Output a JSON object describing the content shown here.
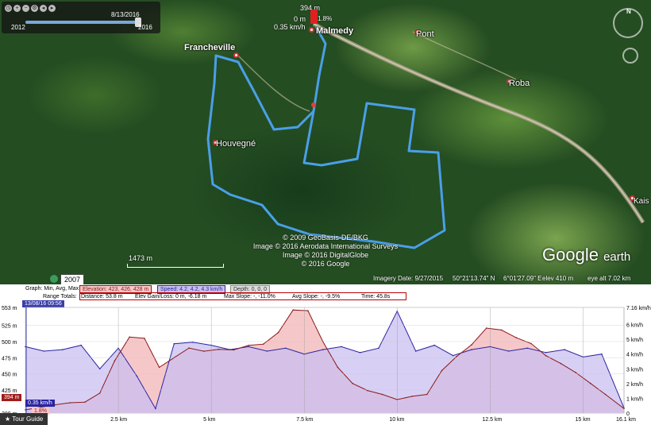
{
  "map": {
    "places": [
      {
        "name": "Francheville"
      },
      {
        "name": "Malmedy"
      },
      {
        "name": "Pont"
      },
      {
        "name": "Roba"
      },
      {
        "name": "Houvegné"
      },
      {
        "name": "Kais"
      }
    ],
    "copyright_lines": [
      "© 2009 GeoBasis-DE/BKG",
      "Image © 2016 Aerodata International Surveys",
      "Image © 2016 DigitalGlobe",
      "© 2016 Google"
    ],
    "logo_text": "Google",
    "logo_suffix": "earth",
    "status": {
      "imagery_date": "Imagery Date: 9/27/2015",
      "lat": "50°21'13.74\" N",
      "lon": "6°01'27.09\" E",
      "elev": "elev   410 m",
      "eye_alt": "eye alt   7.02 km"
    },
    "scale_label": "1473 m",
    "year": "2007",
    "track_cursor": {
      "elev": "394 m",
      "dist": "0 m",
      "speed": "0.35 km/h",
      "slope": "1.8%"
    },
    "track_color": "#4a9fe8"
  },
  "timeslider": {
    "date": "8/13/2016",
    "start_year": "2012",
    "end_year": "2016",
    "icons": [
      "clock-icon",
      "zoom-in-icon",
      "zoom-out-icon",
      "settings-icon",
      "back-icon",
      "forward-icon"
    ]
  },
  "nav": {
    "compass_letter": "N"
  },
  "elevation_profile": {
    "graph_line": "Graph: Min, Avg, Max",
    "elevation": "Elevation: 423, 426, 428 m",
    "speed": "Speed: 4.2, 4.2, 4.3 km/h",
    "depth": "Depth: 0, 0, 0",
    "range_totals": "Range Totals:",
    "distance": "Distance: 53.8 m",
    "gain_loss": "Elev Gain/Loss: 0 m, -6.18 m",
    "max_slope": "Max Slope: -, -11.0%",
    "avg_slope": "Avg Slope: -, -9.5%",
    "time": "Time: 45.8s",
    "cursor_time": "13/08/16 09:56",
    "cursor_elev": "394 m",
    "cursor_speed": "0.35 km/h",
    "cursor_slope": "1.8%",
    "tour_guide": "Tour Guide",
    "colors": {
      "elevation_fill": "#f6c7c9",
      "speed_fill": "#c9bff0",
      "speed_line": "#2a24a0",
      "elevation_line": "#8a1b1b"
    }
  },
  "chart_data": {
    "type": "area",
    "x_unit": "km",
    "x_ticks": [
      "2.5 km",
      "5 km",
      "7.5 km",
      "10 km",
      "12.5 km",
      "15 km",
      "16.1 km"
    ],
    "y_left_ticks": [
      "553 m",
      "525 m",
      "500 m",
      "475 m",
      "450 m",
      "425 m",
      "389 m"
    ],
    "y_right_ticks": [
      "7.16 km/h",
      "6 km/h",
      "5 km/h",
      "4 km/h",
      "3 km/h",
      "2 km/h",
      "1 km/h",
      "0"
    ],
    "ylim_left": [
      389,
      553
    ],
    "ylim_right": [
      0,
      7.16
    ],
    "xlim": [
      0,
      16.1
    ],
    "series": [
      {
        "name": "Elevation",
        "x": [
          0,
          0.4,
          0.8,
          1.2,
          1.6,
          2.0,
          2.4,
          2.8,
          3.2,
          3.6,
          4.0,
          4.4,
          4.8,
          5.2,
          5.6,
          6.0,
          6.4,
          6.8,
          7.2,
          7.6,
          8.0,
          8.4,
          8.8,
          9.2,
          9.6,
          10.0,
          10.4,
          10.8,
          11.2,
          11.6,
          12.0,
          12.4,
          12.8,
          13.2,
          13.6,
          14.0,
          14.4,
          14.8,
          15.2,
          15.6,
          16.1
        ],
        "values": [
          394,
          398,
          402,
          405,
          406,
          420,
          470,
          507,
          505,
          460,
          475,
          490,
          485,
          488,
          487,
          494,
          496,
          514,
          549,
          548,
          500,
          460,
          435,
          424,
          418,
          410,
          415,
          418,
          455,
          477,
          495,
          521,
          518,
          506,
          497,
          478,
          466,
          452,
          435,
          418,
          396
        ]
      },
      {
        "name": "Speed",
        "x": [
          0,
          0.5,
          1.0,
          1.5,
          2.0,
          2.5,
          3.0,
          3.5,
          4.0,
          4.5,
          5.0,
          5.5,
          6.0,
          6.5,
          7.0,
          7.5,
          8.0,
          8.5,
          9.0,
          9.5,
          10.0,
          10.5,
          11.0,
          11.5,
          12.0,
          12.5,
          13.0,
          13.5,
          14.0,
          14.5,
          15.0,
          15.5,
          16.1
        ],
        "values": [
          4.5,
          4.2,
          4.3,
          4.6,
          3.0,
          4.4,
          2.5,
          0.3,
          4.7,
          4.8,
          4.6,
          4.3,
          4.5,
          4.2,
          4.4,
          4.0,
          4.3,
          4.5,
          4.1,
          4.4,
          6.9,
          4.2,
          4.6,
          3.9,
          4.3,
          4.5,
          4.2,
          4.4,
          4.1,
          4.3,
          3.8,
          4.0,
          0.35
        ]
      }
    ]
  }
}
